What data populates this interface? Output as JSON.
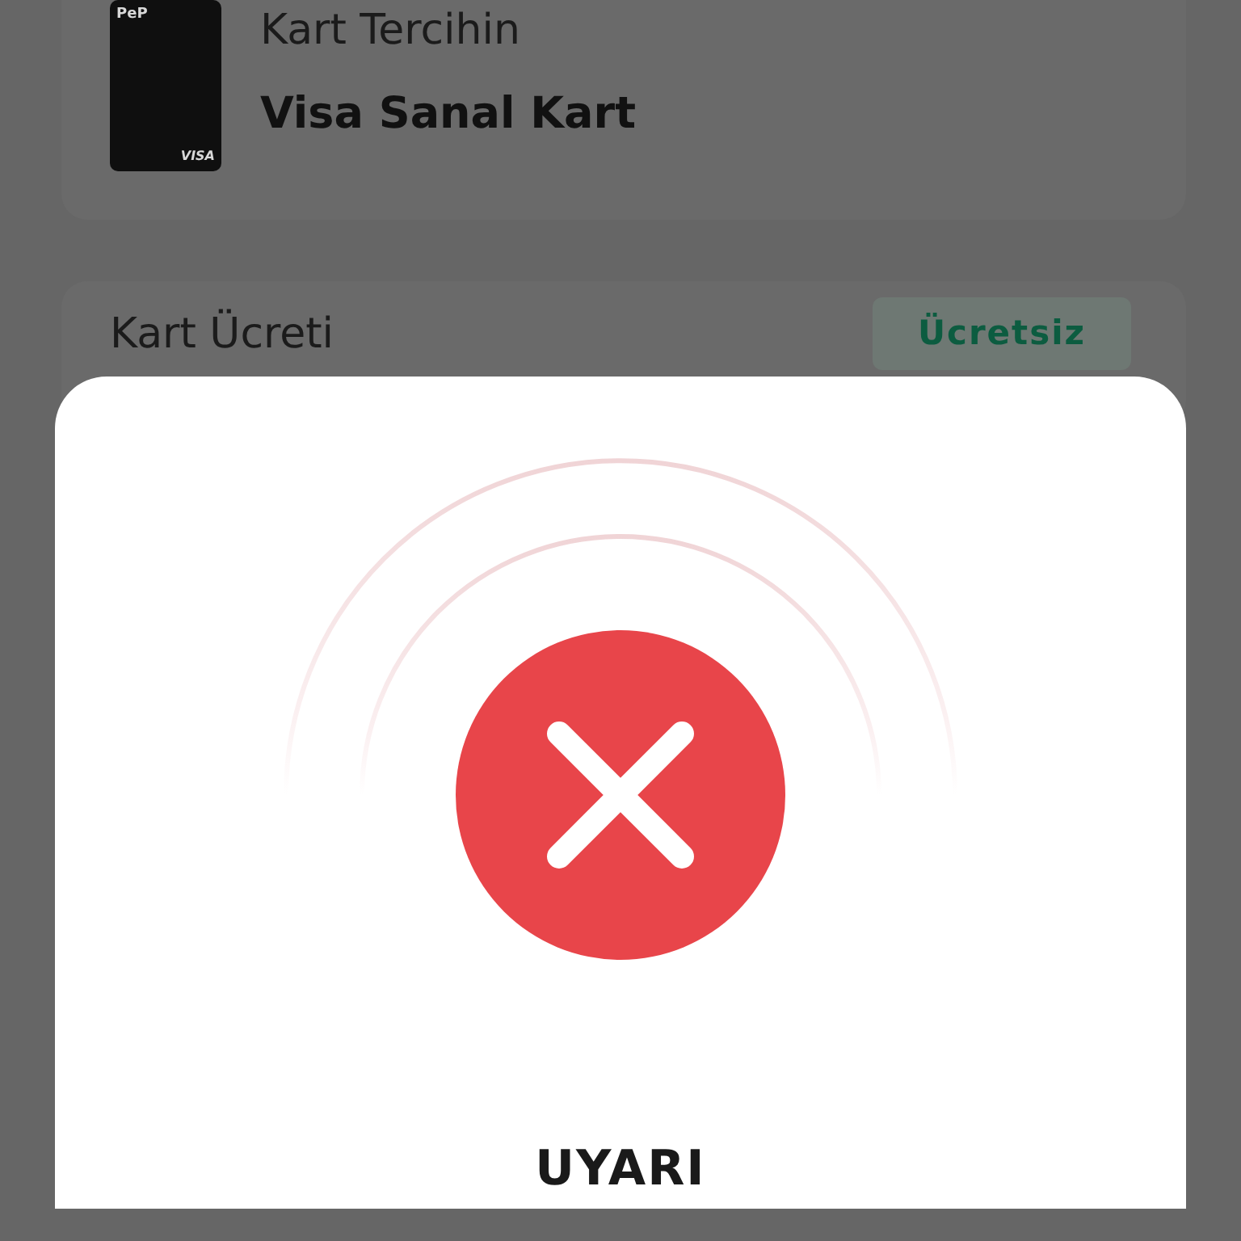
{
  "card_preference": {
    "label": "Kart Tercihin",
    "value": "Visa Sanal Kart",
    "card_image": {
      "brand": "PeP",
      "network": "VISA"
    }
  },
  "card_fee": {
    "label": "Kart Ücreti",
    "badge": "Ücretsiz"
  },
  "alert": {
    "title": "UYARI"
  }
}
